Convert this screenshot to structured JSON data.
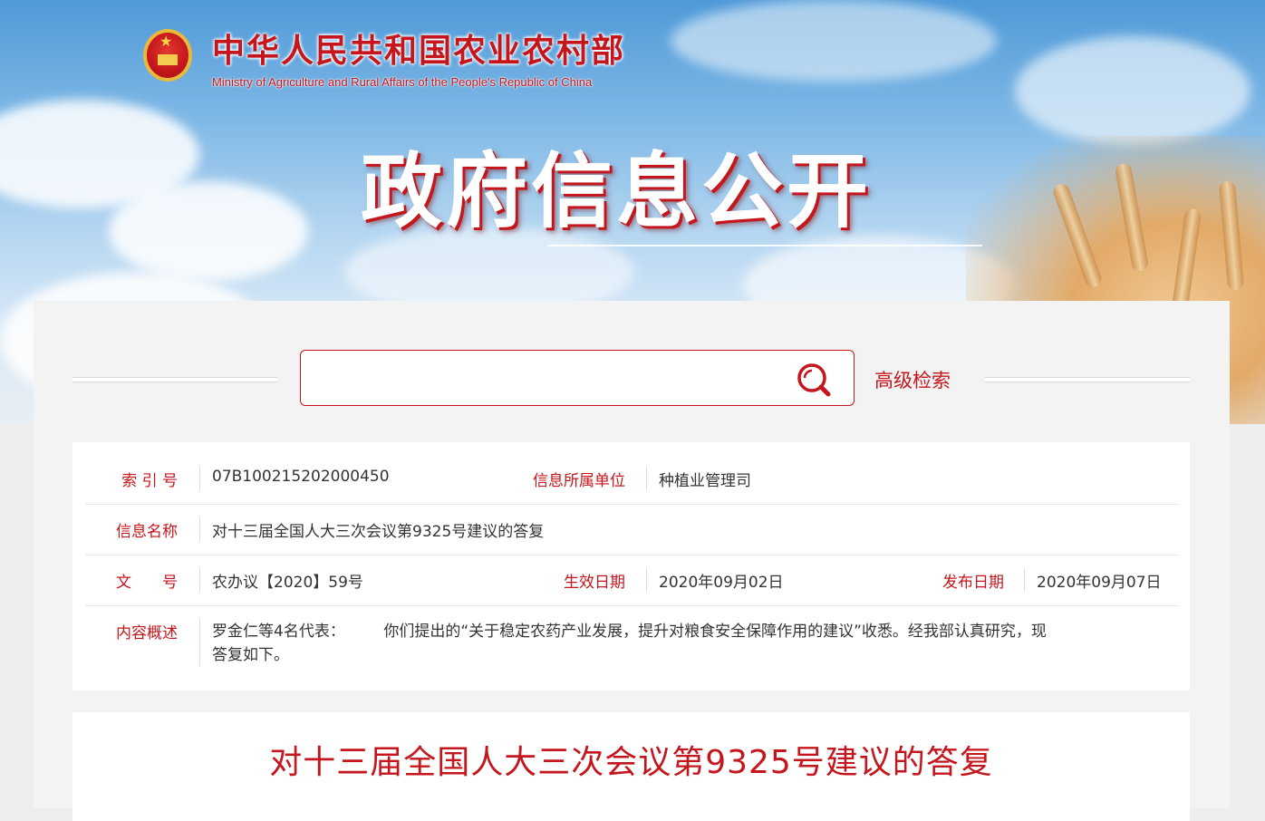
{
  "header": {
    "site_name_cn": "中华人民共和国农业农村部",
    "site_name_en": "Ministry of Agriculture and Rural Affairs of the People's Republic of China",
    "section_title": "政府信息公开"
  },
  "search": {
    "placeholder": "",
    "value": "",
    "advanced_label": "高级检索"
  },
  "info": {
    "index_label": "索 引 号",
    "index_value": "07B100215202000450",
    "unit_label": "信息所属单位",
    "unit_value": "种植业管理司",
    "name_label": "信息名称",
    "name_value": "对十三届全国人大三次会议第9325号建议的答复",
    "doc_label": "文　　号",
    "doc_value": "农办议【2020】59号",
    "effective_label": "生效日期",
    "effective_value": "2020年09月02日",
    "publish_label": "发布日期",
    "publish_value": "2020年09月07日",
    "summary_label": "内容概述",
    "summary_value_line1": "罗金仁等4名代表：　　　你们提出的“关于稳定农药产业发展，提升对粮食安全保障作用的建议”收悉。经我部认真研究，现",
    "summary_value_line2": "答复如下。"
  },
  "content": {
    "title": "对十三届全国人大三次会议第9325号建议的答复"
  },
  "colors": {
    "accent": "#c4161c",
    "text": "#333333",
    "panel_bg": "#f3f3f3"
  },
  "icons": {
    "emblem": "national-emblem-icon",
    "search": "search-icon"
  }
}
